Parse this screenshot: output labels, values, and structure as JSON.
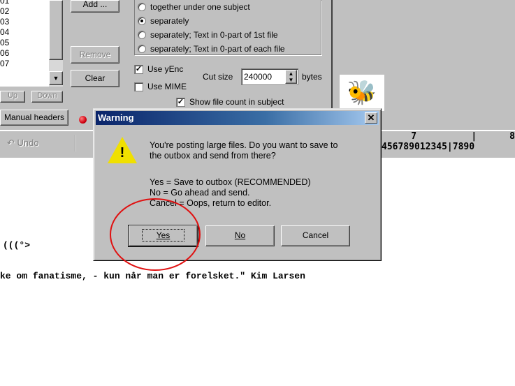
{
  "attachments": {
    "files": [
      "01",
      "02",
      "03",
      "04",
      "05",
      "06",
      "07"
    ],
    "add_label": "Add ...",
    "remove_label": "Remove",
    "clear_label": "Clear",
    "up_label": "Up",
    "down_label": "Down"
  },
  "posting": {
    "options": [
      "together under one subject",
      "separately",
      "separately; Text in 0-part of 1st file",
      "separately; Text in 0-part of each file"
    ],
    "selected": 1,
    "use_yenc": {
      "label": "Use yEnc",
      "checked": true
    },
    "use_mime": {
      "label": "Use MIME",
      "checked": false
    },
    "cut_size_label": "Cut size",
    "cut_size_value": "240000",
    "cut_size_unit": "bytes",
    "show_file_count": {
      "label": "Show file count in subject",
      "checked": true
    }
  },
  "tabs": {
    "manual_headers": "Manual headers"
  },
  "toolbar": {
    "undo_label": "Undo"
  },
  "ruler": {
    "line1": "7          |      8",
    "line2": "456789012345|7890"
  },
  "editor": {
    "lines": [
      "(((°>",
      "ke om fanatisme, - kun når man er forelsket.\" Kim Larsen"
    ]
  },
  "dialog": {
    "title": "Warning",
    "message": [
      "You're posting large files.  Do you want to save to",
      "the outbox and send from there?"
    ],
    "options_text": [
      "Yes = Save to outbox (RECOMMENDED)",
      "No = Go ahead and send.",
      "Cancel = Oops, return to editor."
    ],
    "yes_label": "Yes",
    "no_label": "No",
    "cancel_label": "Cancel",
    "close_glyph": "✕",
    "warning_glyph": "!"
  },
  "colors": {
    "highlight_circle": "#e01010",
    "title_bar": "#0a246a"
  }
}
